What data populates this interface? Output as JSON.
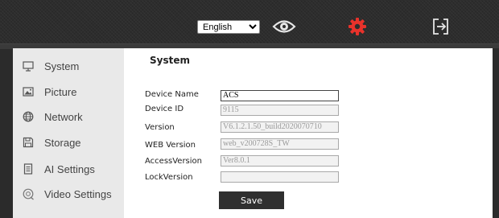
{
  "topbar": {
    "language": {
      "selected": "English",
      "options": [
        "English"
      ]
    },
    "icons": {
      "preview": "eye-icon",
      "settings": "gear-icon",
      "logout": "logout-icon"
    },
    "colors": {
      "settings_active": "#e8322b",
      "icon_default": "#e6e6e6"
    }
  },
  "sidebar": {
    "items": [
      {
        "label": "System",
        "icon": "monitor-icon"
      },
      {
        "label": "Picture",
        "icon": "picture-icon"
      },
      {
        "label": "Network",
        "icon": "globe-icon"
      },
      {
        "label": "Storage",
        "icon": "save-disk-icon"
      },
      {
        "label": "AI Settings",
        "icon": "document-icon"
      },
      {
        "label": "Video Settings",
        "icon": "video-icon"
      }
    ]
  },
  "main": {
    "title": "System",
    "fields": [
      {
        "label": "Device Name",
        "value": "ACS",
        "editable": true
      },
      {
        "label": "Device ID",
        "value": "9115",
        "editable": false
      },
      {
        "label": "Version",
        "value": "V6.1.2.1.50_build2020070710",
        "editable": false
      },
      {
        "label": "WEB Version",
        "value": "web_v200728S_TW",
        "editable": false
      },
      {
        "label": "AccessVersion",
        "value": "Ver8.0.1",
        "editable": false
      },
      {
        "label": "LockVersion",
        "value": "",
        "editable": false
      }
    ],
    "save_label": "Save"
  }
}
